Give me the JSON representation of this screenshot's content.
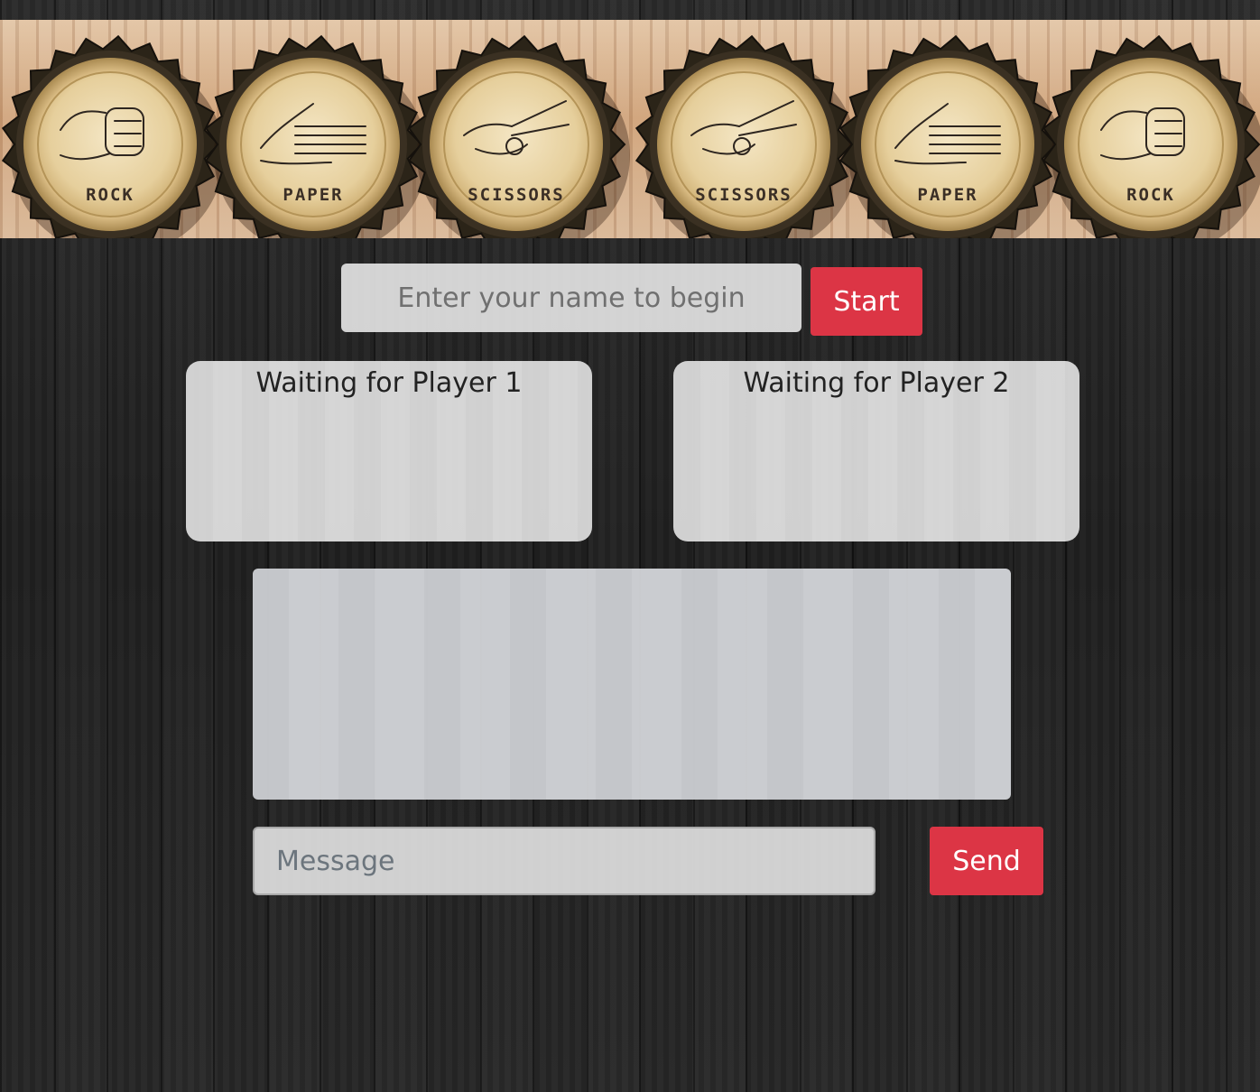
{
  "banner": {
    "caps": [
      {
        "label": "ROCK",
        "icon": "rock-fist-icon"
      },
      {
        "label": "PAPER",
        "icon": "paper-hand-icon"
      },
      {
        "label": "SCISSORS",
        "icon": "scissors-hand-icon"
      },
      {
        "label": "SCISSORS",
        "icon": "scissors-hand-icon"
      },
      {
        "label": "PAPER",
        "icon": "paper-hand-icon"
      },
      {
        "label": "ROCK",
        "icon": "rock-fist-icon"
      }
    ]
  },
  "login": {
    "name_placeholder": "Enter your name to begin",
    "name_value": "",
    "start_label": "Start"
  },
  "players": {
    "player1_status": "Waiting for Player 1",
    "player2_status": "Waiting for Player 2"
  },
  "chat": {
    "messages": [],
    "message_placeholder": "Message",
    "message_value": "",
    "send_label": "Send"
  },
  "colors": {
    "accent": "#dc3545",
    "background": "#1e1e1e",
    "panel": "#dedede"
  }
}
